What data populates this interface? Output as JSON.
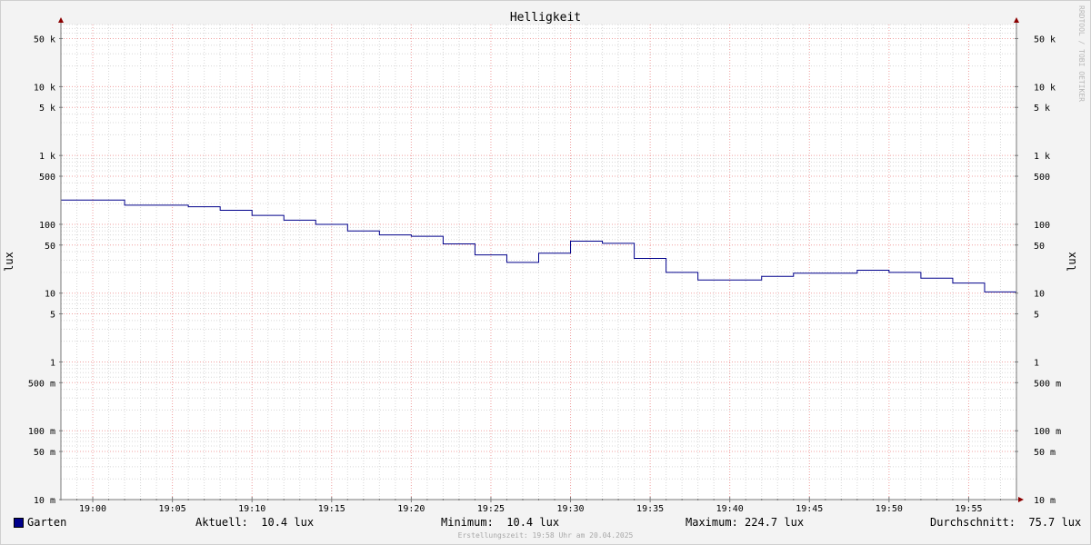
{
  "chart_data": {
    "type": "line",
    "title": "Helligkeit",
    "ylabel": "lux",
    "y_scale": "log",
    "ylim": [
      0.01,
      80000
    ],
    "y_ticks": [
      {
        "value": 50000,
        "label": "50 k"
      },
      {
        "value": 10000,
        "label": "10 k"
      },
      {
        "value": 5000,
        "label": "5 k"
      },
      {
        "value": 1000,
        "label": "1 k"
      },
      {
        "value": 500,
        "label": "500"
      },
      {
        "value": 100,
        "label": "100"
      },
      {
        "value": 50,
        "label": "50"
      },
      {
        "value": 10,
        "label": "10"
      },
      {
        "value": 5,
        "label": "5"
      },
      {
        "value": 1,
        "label": "1"
      },
      {
        "value": 0.5,
        "label": "500 m"
      },
      {
        "value": 0.1,
        "label": "100 m"
      },
      {
        "value": 0.05,
        "label": "50 m"
      },
      {
        "value": 0.01,
        "label": "10 m"
      }
    ],
    "x_ticks": [
      "19:00",
      "19:05",
      "19:10",
      "19:15",
      "19:20",
      "19:25",
      "19:30",
      "19:35",
      "19:40",
      "19:45",
      "19:50",
      "19:55"
    ],
    "xlim": [
      "18:58",
      "19:58"
    ],
    "grid": true,
    "series": [
      {
        "name": "Garten",
        "color": "#00008b",
        "step": true,
        "x": [
          "18:58",
          "19:02",
          "19:06",
          "19:08",
          "19:10",
          "19:12",
          "19:14",
          "19:16",
          "19:18",
          "19:20",
          "19:22",
          "19:24",
          "19:26",
          "19:28",
          "19:30",
          "19:32",
          "19:34",
          "19:36",
          "19:38",
          "19:42",
          "19:44",
          "19:48",
          "19:50",
          "19:52",
          "19:54",
          "19:56",
          "19:58"
        ],
        "values": [
          224.7,
          190,
          180,
          160,
          135,
          115,
          100,
          80,
          70,
          67,
          52,
          36,
          28,
          38,
          57,
          53,
          32,
          20,
          15.5,
          17.5,
          19.5,
          21.5,
          20,
          16.5,
          14,
          10.4,
          10.4
        ]
      }
    ]
  },
  "legend": {
    "series_name": "Garten",
    "current": "Aktuell:  10.4 lux",
    "minimum": "Minimum:  10.4 lux",
    "maximum": "Maximum: 224.7 lux",
    "average": "Durchschnitt:  75.7 lux"
  },
  "footer": "Erstellungszeit: 19:58 Uhr am 20.04.2025",
  "credit": "RRDTOOL / TOBI OETIKER",
  "colors": {
    "background": "#f3f3f3",
    "canvas": "#ffffff",
    "series": "#00008b",
    "major_grid": "#f0a0a0",
    "minor_grid": "#d8d8d8",
    "arrow": "#8b0000"
  }
}
